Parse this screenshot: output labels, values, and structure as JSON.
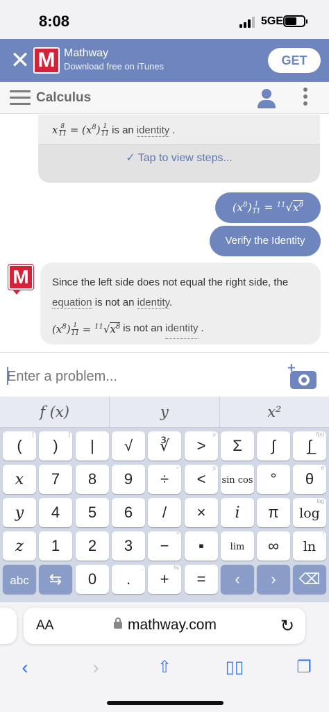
{
  "status": {
    "time": "8:08",
    "network": "5GE"
  },
  "banner": {
    "close_icon": "x-icon",
    "app_name": "Mathway",
    "subtitle": "Download free on iTunes",
    "get_label": "GET",
    "logo_letter": "M"
  },
  "nav": {
    "title": "Calculus",
    "menu_icon": "hamburger-icon",
    "user_icon": "user-icon",
    "more_icon": "kebab-icon"
  },
  "chat": {
    "prev_result": {
      "text": "is an",
      "link": "identity",
      "tail": ".",
      "steps_label": "Tap to view steps..."
    },
    "user_expr": {
      "lhs_base": "x",
      "lhs_exp": "8",
      "frac_num": "1",
      "frac_den": "11",
      "eq": "=",
      "root_index": "11",
      "rad_base": "x",
      "rad_exp": "8"
    },
    "user_command": "Verify the Identity",
    "answer": {
      "sentence": "Since the left side does not equal the right side, the",
      "link1": "equation",
      "mid": "is not an",
      "link2": "identity",
      "dot": ".",
      "eq_text": "is not an",
      "eq_link": "identity",
      "eq_dot": "."
    }
  },
  "input": {
    "placeholder": "Enter a problem..."
  },
  "keyboard": {
    "tabs": [
      "f (x)",
      "y",
      "x²"
    ],
    "rows": [
      [
        {
          "label": "(",
          "corner": "["
        },
        {
          "label": ")",
          "corner": "]"
        },
        {
          "label": "|",
          "corner": ""
        },
        {
          "label": "√",
          "corner": ""
        },
        {
          "label": "∛",
          "corner": ""
        },
        {
          "label": ">",
          "corner": "≥"
        },
        {
          "label": "Σ",
          "corner": ""
        },
        {
          "label": "∫",
          "corner": ""
        },
        {
          "label": "∫̲",
          "corner": "f(x)"
        }
      ],
      [
        {
          "label": "x",
          "corner": ""
        },
        {
          "label": "7",
          "corner": ""
        },
        {
          "label": "8",
          "corner": ""
        },
        {
          "label": "9",
          "corner": ""
        },
        {
          "label": "÷",
          "corner": "÷"
        },
        {
          "label": "<",
          "corner": "≤"
        },
        {
          "label": "sin cos",
          "corner": ""
        },
        {
          "label": "°",
          "corner": ""
        },
        {
          "label": "θ",
          "corner": "e"
        }
      ],
      [
        {
          "label": "y",
          "corner": ""
        },
        {
          "label": "4",
          "corner": ""
        },
        {
          "label": "5",
          "corner": ""
        },
        {
          "label": "6",
          "corner": ""
        },
        {
          "label": "/",
          "corner": ""
        },
        {
          "label": "×",
          "corner": ""
        },
        {
          "label": "i",
          "corner": ""
        },
        {
          "label": "π",
          "corner": ""
        },
        {
          "label": "log",
          "corner": "log"
        }
      ],
      [
        {
          "label": "z",
          "corner": ""
        },
        {
          "label": "1",
          "corner": ""
        },
        {
          "label": "2",
          "corner": ""
        },
        {
          "label": "3",
          "corner": ""
        },
        {
          "label": "−",
          "corner": "^"
        },
        {
          "label": "▪",
          "corner": ""
        },
        {
          "label": "lim",
          "corner": ""
        },
        {
          "label": "∞",
          "corner": ""
        },
        {
          "label": "ln",
          "corner": "!"
        }
      ],
      [
        {
          "label": "abc",
          "corner": ""
        },
        {
          "label": "⇆",
          "corner": ""
        },
        {
          "label": "0",
          "corner": ""
        },
        {
          "label": ".",
          "corner": ","
        },
        {
          "label": "+",
          "corner": "%"
        },
        {
          "label": "=",
          "corner": ""
        },
        {
          "label": "‹",
          "corner": ""
        },
        {
          "label": "›",
          "corner": ""
        },
        {
          "label": "⌫",
          "corner": ""
        }
      ]
    ]
  },
  "browser": {
    "aa_label": "AA",
    "domain": "mathway.com"
  },
  "colors": {
    "accent": "#6e86bd",
    "brand_red": "#d2233b",
    "link_blue": "#3478f6"
  }
}
